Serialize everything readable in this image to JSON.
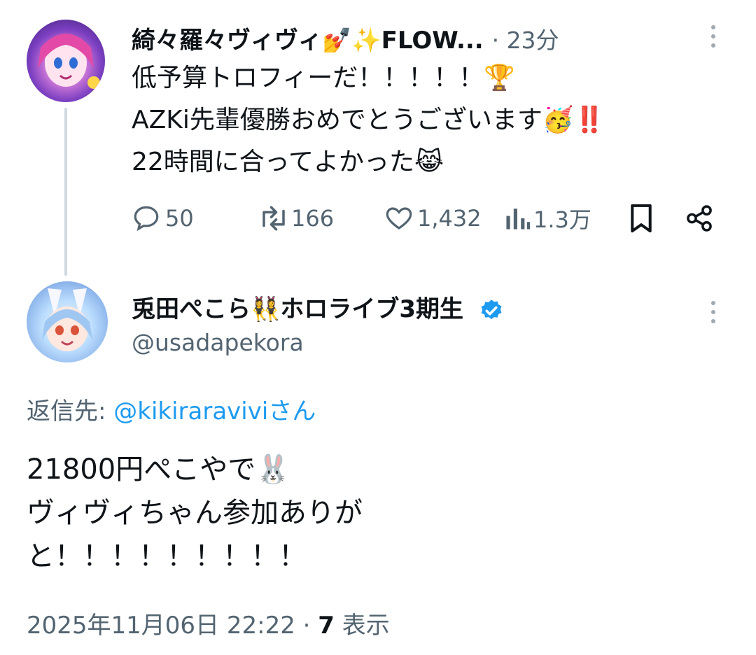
{
  "tweet1": {
    "display_name": "綺々羅々ヴィヴィ💅✨FLOW...",
    "time": "23分",
    "lines": [
      "低予算トロフィーだ！！！！！🏆",
      "AZKi先輩優勝おめでとうございます🥳‼️",
      "22時間に合ってよかった😹"
    ],
    "actions": {
      "reply_count": "50",
      "retweet_count": "166",
      "like_count": "1,432",
      "view_count": "1.3万"
    }
  },
  "tweet2": {
    "display_name": "兎田ぺこら👯‍♀️ホロライブ3期生",
    "handle": "@usadapekora",
    "reply_to_label": "返信先:",
    "reply_to_handle": "@kikiraraviviさん",
    "lines": [
      "21800円ぺこやで🐰",
      "ヴィヴィちゃん参加ありが",
      "と！！！！！！！！！"
    ],
    "timestamp": "2025年11月06日 22:22",
    "views_number": "7",
    "views_label": "表示"
  },
  "icons": {
    "reply": "reply-icon",
    "retweet": "retweet-icon",
    "like": "heart-icon",
    "views": "views-icon",
    "bookmark": "bookmark-icon",
    "share": "share-icon",
    "more": "more-vertical-icon",
    "verified": "verified-badge-icon"
  },
  "colors": {
    "text": "#0f1419",
    "secondary": "#536471",
    "link": "#1d9bf0",
    "verified": "#1d9bf0"
  }
}
